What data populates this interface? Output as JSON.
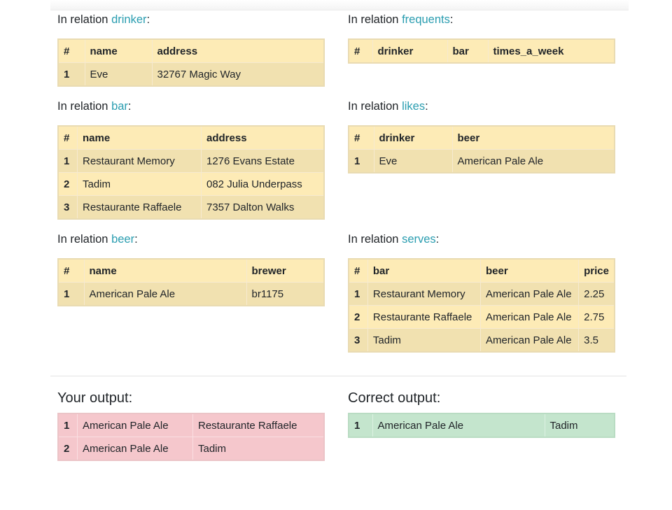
{
  "prefix": "In relation",
  "colon": ":",
  "relations": {
    "drinker": {
      "name": "drinker",
      "headers": [
        "#",
        "name",
        "address"
      ],
      "rows": [
        [
          "1",
          "Eve",
          "32767 Magic Way"
        ]
      ]
    },
    "frequents": {
      "name": "frequents",
      "headers": [
        "#",
        "drinker",
        "bar",
        "times_a_week"
      ],
      "rows": []
    },
    "bar": {
      "name": "bar",
      "headers": [
        "#",
        "name",
        "address"
      ],
      "rows": [
        [
          "1",
          "Restaurant Memory",
          "1276 Evans Estate"
        ],
        [
          "2",
          "Tadim",
          "082 Julia Underpass"
        ],
        [
          "3",
          "Restaurante Raffaele",
          "7357 Dalton Walks"
        ]
      ]
    },
    "likes": {
      "name": "likes",
      "headers": [
        "#",
        "drinker",
        "beer"
      ],
      "rows": [
        [
          "1",
          "Eve",
          "American Pale Ale"
        ]
      ]
    },
    "beer": {
      "name": "beer",
      "headers": [
        "#",
        "name",
        "brewer"
      ],
      "rows": [
        [
          "1",
          "American Pale Ale",
          "br1175"
        ]
      ]
    },
    "serves": {
      "name": "serves",
      "headers": [
        "#",
        "bar",
        "beer",
        "price"
      ],
      "rows": [
        [
          "1",
          "Restaurant Memory",
          "American Pale Ale",
          "2.25"
        ],
        [
          "2",
          "Restaurante Raffaele",
          "American Pale Ale",
          "2.75"
        ],
        [
          "3",
          "Tadim",
          "American Pale Ale",
          "3.5"
        ]
      ]
    }
  },
  "your_output": {
    "title": "Your output:",
    "rows": [
      [
        "1",
        "American Pale Ale",
        "Restaurante Raffaele"
      ],
      [
        "2",
        "American Pale Ale",
        "Tadim"
      ]
    ]
  },
  "correct_output": {
    "title": "Correct output:",
    "rows": [
      [
        "1",
        "American Pale Ale",
        "Tadim"
      ]
    ]
  },
  "colors": {
    "header": "#fdebb6",
    "row_dark": "#f1e1b0",
    "link": "#2a9db0",
    "wrong": "#f5c7cc",
    "correct": "#c4e5cd"
  }
}
